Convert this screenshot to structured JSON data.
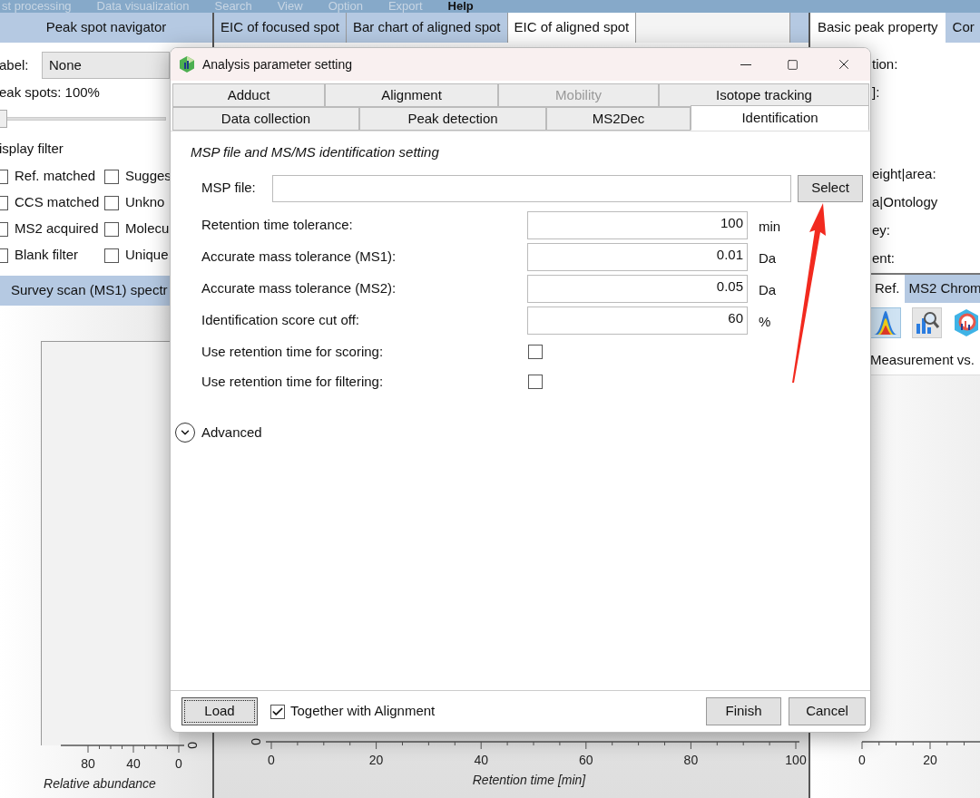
{
  "menu_bar": [
    {
      "label": "st processing",
      "selected": false
    },
    {
      "label": "Data visualization",
      "selected": false
    },
    {
      "label": "Search",
      "selected": false
    },
    {
      "label": "View",
      "selected": false
    },
    {
      "label": "Option",
      "selected": false
    },
    {
      "label": "Export",
      "selected": false
    },
    {
      "label": "Help",
      "selected": true
    }
  ],
  "left_panel": {
    "tab": "Peak spot navigator",
    "label_field": {
      "label": "abel:",
      "value": "None"
    },
    "slider": {
      "label": "eak spots: 100%",
      "level": 0
    },
    "filter_title": "isplay filter",
    "filters": [
      {
        "label": "Ref. matched",
        "checked": false
      },
      {
        "label": "Sugges",
        "checked": false
      },
      {
        "label": "CCS matched",
        "checked": false
      },
      {
        "label": "Unkno",
        "checked": false
      },
      {
        "label": "MS2 acquired",
        "checked": false
      },
      {
        "label": "Molecu",
        "checked": false
      },
      {
        "label": "Blank filter",
        "checked": false
      },
      {
        "label": "Unique",
        "checked": false
      }
    ],
    "spectrum_tab": "Survey scan (MS1) spectr",
    "spectrum_chart": {
      "xticks": [
        "80",
        "40",
        "0"
      ],
      "ytick": "0",
      "xlabel": "Relative abundance"
    }
  },
  "center_panel": {
    "tabs": [
      {
        "label": "EIC of focused spot",
        "selected": false
      },
      {
        "label": "Bar chart of aligned spot",
        "selected": false
      },
      {
        "label": "EIC of aligned spot",
        "selected": true
      }
    ],
    "chart": {
      "ytick": "0",
      "xticks": [
        "0",
        "20",
        "40",
        "60",
        "80",
        "100"
      ],
      "xlabel": "Retention time [min]"
    }
  },
  "right_panel": {
    "tabs": [
      {
        "label": "Basic peak property",
        "selected": true
      },
      {
        "label": "Cor",
        "selected": false
      }
    ],
    "properties": [
      "tion:",
      "]:",
      "eight|area:",
      "a|Ontology",
      "ey:",
      "ent:"
    ],
    "bottom_tabs": [
      {
        "label": "Ref.",
        "selected": true
      },
      {
        "label": "MS2 Chrom",
        "selected": false
      }
    ],
    "plot_title": "Measurement vs.",
    "xticks": [
      "0",
      "20"
    ]
  },
  "dialog": {
    "title": "Analysis parameter setting",
    "tab_rows": [
      [
        {
          "label": "Adduct",
          "selected": false,
          "disabled": false
        },
        {
          "label": "Alignment",
          "selected": false,
          "disabled": false
        },
        {
          "label": "Mobility",
          "selected": false,
          "disabled": true
        },
        {
          "label": "Isotope tracking",
          "selected": false,
          "disabled": false
        }
      ],
      [
        {
          "label": "Data collection",
          "selected": false,
          "disabled": false
        },
        {
          "label": "Peak detection",
          "selected": false,
          "disabled": false
        },
        {
          "label": "MS2Dec",
          "selected": false,
          "disabled": false
        },
        {
          "label": "Identification",
          "selected": true,
          "disabled": false
        }
      ]
    ],
    "heading": "MSP file and MS/MS identification setting",
    "msp": {
      "label": "MSP file:",
      "button": "Select"
    },
    "fields": [
      {
        "kind": "text",
        "label": "Retention time tolerance:",
        "value": "100",
        "unit": "min"
      },
      {
        "kind": "text",
        "label": "Accurate mass tolerance (MS1):",
        "value": "0.01",
        "unit": "Da"
      },
      {
        "kind": "text",
        "label": "Accurate mass tolerance (MS2):",
        "value": "0.05",
        "unit": "Da"
      },
      {
        "kind": "text",
        "label": "Identification score cut off:",
        "value": "60",
        "unit": "%"
      },
      {
        "kind": "checkbox",
        "label": "Use retention time for scoring:",
        "checked": false
      },
      {
        "kind": "checkbox",
        "label": "Use retention time for filtering:",
        "checked": false
      }
    ],
    "advanced": {
      "label": "Advanced",
      "expanded": false
    },
    "load_button": "Load",
    "together": {
      "label": "Together with Alignment",
      "checked": true
    },
    "buttons": [
      "Finish",
      "Cancel"
    ]
  }
}
